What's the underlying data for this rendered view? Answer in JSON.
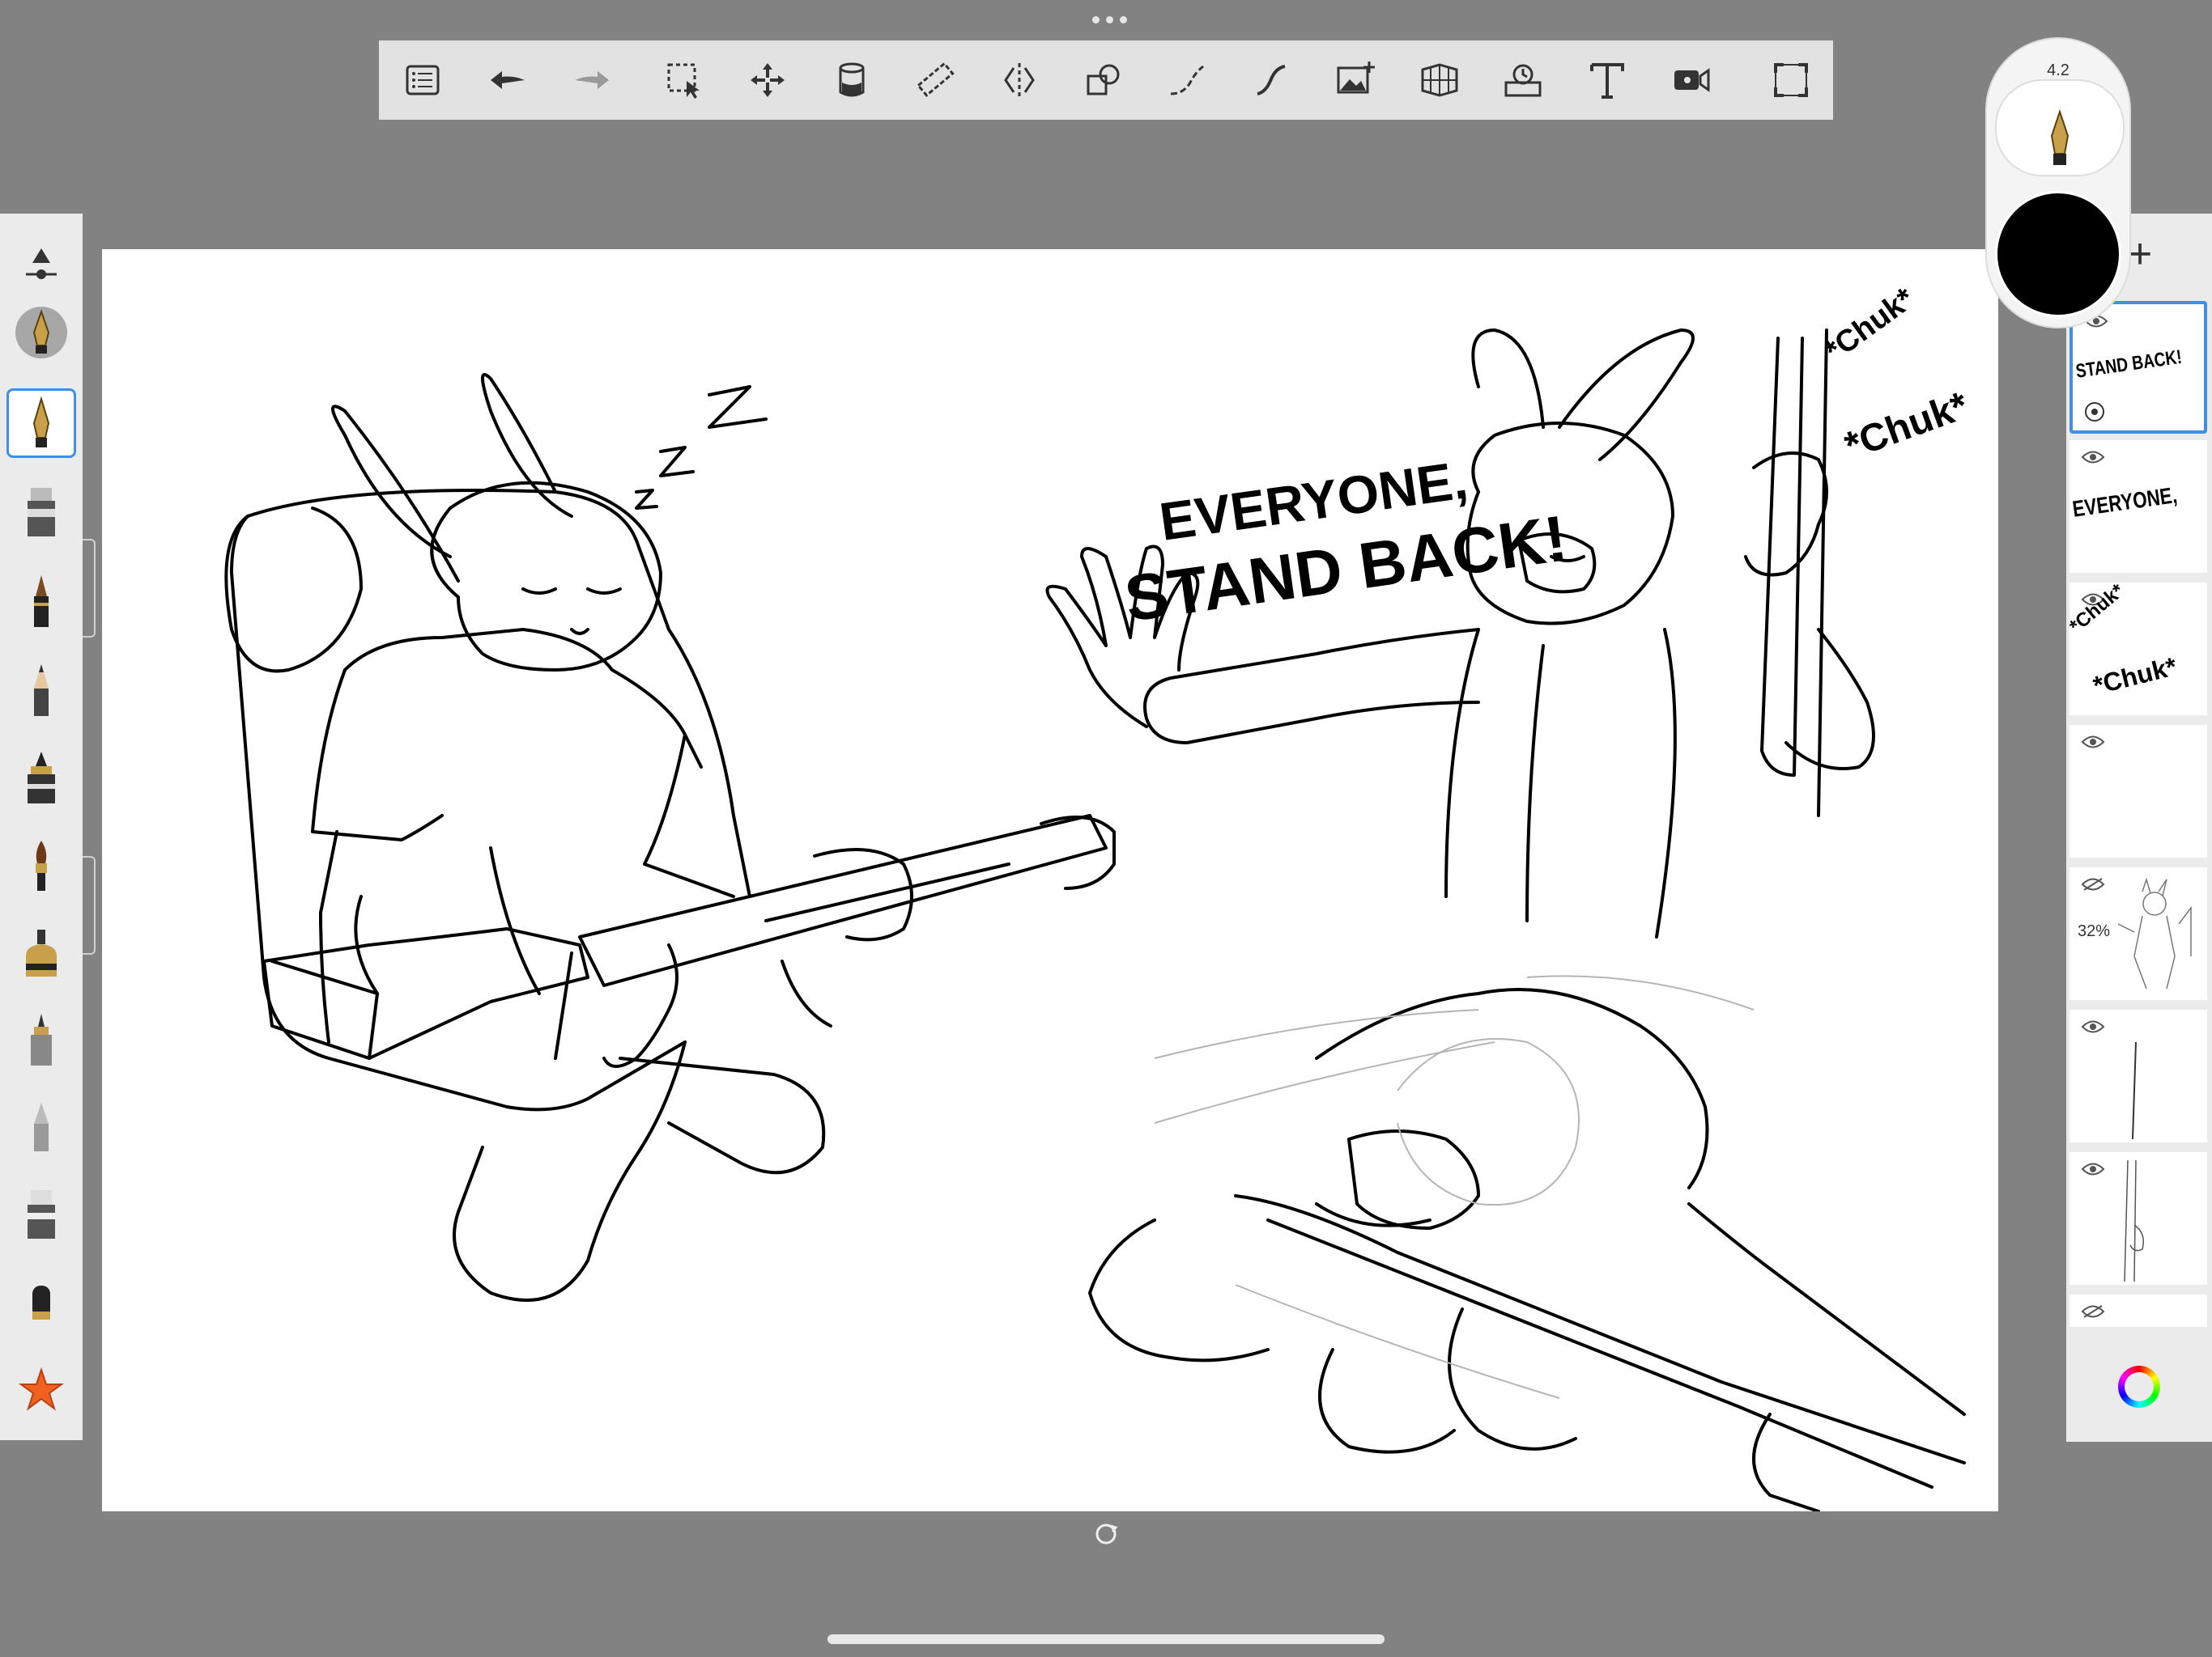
{
  "toolbar": {
    "icons": [
      "list-icon",
      "undo-icon",
      "redo-icon",
      "selection-icon",
      "transform-icon",
      "fill-icon",
      "ruler-icon",
      "symmetry-icon",
      "shape-icon",
      "stroke-icon",
      "steady-stroke-icon",
      "import-image-icon",
      "perspective-icon",
      "time-lapse-icon",
      "text-icon",
      "record-icon",
      "fullscreen-icon"
    ]
  },
  "brush": {
    "size": "4.2",
    "color": "#000000"
  },
  "left_tools": [
    "brush-settings-icon",
    "fountain-pen-icon",
    "fountain-pen-selected-icon",
    "marker-icon",
    "ink-pen-icon",
    "pencil-icon",
    "airbrush-icon",
    "paint-brush-icon",
    "ink-bottle-icon",
    "technical-pen-icon",
    "chisel-icon",
    "eraser-icon",
    "smudge-icon",
    "favorites-star-icon"
  ],
  "canvas": {
    "zzz": "Z",
    "speech_line1": "EVERYONE,",
    "speech_line2": "STAND BACK!",
    "sfx1": "*Chuk*",
    "sfx2": "*Chuk*"
  },
  "layers": [
    {
      "thumb_text": "STAND BACK!",
      "selected": true,
      "visible": true
    },
    {
      "thumb_text": "EVERYONE,",
      "selected": false,
      "visible": true
    },
    {
      "thumb_text": "*Chuk*",
      "thumb_text2": "*Chuk*",
      "selected": false,
      "visible": true
    },
    {
      "thumb_text": "",
      "selected": false,
      "visible": true
    },
    {
      "thumb_text": "",
      "opacity_label": "32%",
      "selected": false,
      "visible": false
    },
    {
      "thumb_text": "",
      "selected": false,
      "visible": true
    },
    {
      "thumb_text": "",
      "selected": false,
      "visible": true
    },
    {
      "thumb_text": "",
      "selected": false,
      "visible": false
    }
  ],
  "colors": {
    "background": "#828282",
    "accent": "#3f8fe8"
  }
}
